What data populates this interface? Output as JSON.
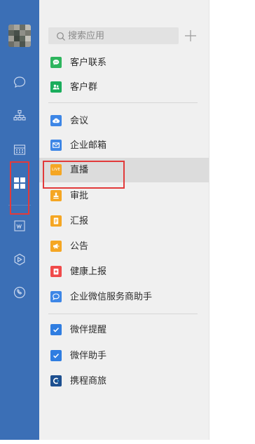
{
  "window": {
    "accent": "#3b6fb6",
    "highlight_color": "#e23a3a"
  },
  "sidebar": {
    "avatar_icon": "user-avatar",
    "items": [
      {
        "name": "chat-icon",
        "active": false
      },
      {
        "name": "org-chart-icon",
        "active": false
      },
      {
        "name": "calendar-icon",
        "active": false
      },
      {
        "name": "workbench-grid-icon",
        "active": true
      },
      {
        "name": "document-icon",
        "active": false
      },
      {
        "name": "hexagon-icon",
        "active": false
      },
      {
        "name": "phone-call-icon",
        "active": false
      }
    ]
  },
  "search": {
    "placeholder": "搜索应用",
    "icon": "search-icon"
  },
  "add_button": {
    "icon": "plus-icon"
  },
  "groups": [
    {
      "apps": [
        {
          "label": "客户联系",
          "icon": "chat-bubble",
          "color": "#2db55d"
        },
        {
          "label": "客户群",
          "icon": "group",
          "color": "#1aad5c"
        }
      ]
    },
    {
      "apps": [
        {
          "label": "会议",
          "icon": "cloud-meeting",
          "color": "#3d86e6"
        },
        {
          "label": "企业邮箱",
          "icon": "mail",
          "color": "#3d86e6"
        },
        {
          "label": "直播",
          "icon": "live",
          "color": "#f5a623",
          "icon_text": "LIVE",
          "active": true
        },
        {
          "label": "审批",
          "icon": "stamp",
          "color": "#f5a623"
        },
        {
          "label": "汇报",
          "icon": "report",
          "color": "#f5a623"
        },
        {
          "label": "公告",
          "icon": "megaphone",
          "color": "#f5a623"
        },
        {
          "label": "健康上报",
          "icon": "health",
          "color": "#f04a4a"
        },
        {
          "label": "企业微信服务商助手",
          "icon": "service-chat",
          "color": "#3d86e6"
        }
      ]
    },
    {
      "apps": [
        {
          "label": "微伴提醒",
          "icon": "check",
          "color": "#2f7de1"
        },
        {
          "label": "微伴助手",
          "icon": "check",
          "color": "#2f7de1"
        },
        {
          "label": "携程商旅",
          "icon": "ctrip",
          "color": "#1d4f8f"
        }
      ]
    }
  ]
}
